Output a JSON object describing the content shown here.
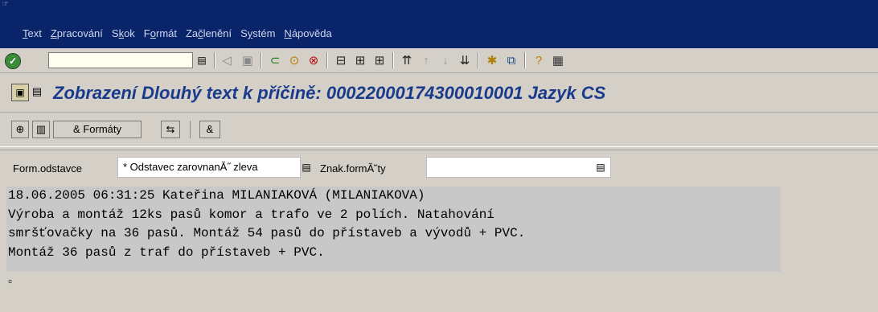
{
  "menubar": {
    "items": [
      {
        "pre": "",
        "u": "T",
        "post": "ext"
      },
      {
        "pre": "",
        "u": "Z",
        "post": "pracování"
      },
      {
        "pre": "S",
        "u": "k",
        "post": "ok"
      },
      {
        "pre": "F",
        "u": "o",
        "post": "rmát"
      },
      {
        "pre": "Za",
        "u": "č",
        "post": "lenění"
      },
      {
        "pre": "S",
        "u": "y",
        "post": "stém"
      },
      {
        "pre": "",
        "u": "N",
        "post": "ápověda"
      }
    ]
  },
  "command_field": {
    "value": ""
  },
  "title": "Zobrazení Dlouhý text k příčině: 00022000174300010001 Jazyk CS",
  "app_toolbar": {
    "formats_label": "Formáty"
  },
  "format_line": {
    "paragraph_label": "Form.odstavce",
    "paragraph_value": "* Odstavec zarovnanĂ˝ zleva",
    "char_label": "Znak.formĂ˘ty",
    "char_value": ""
  },
  "editor": {
    "lines": [
      "18.06.2005 06:31:25 Kateřina MILANIAKOVÁ (MILANIAKOVA)",
      "Výroba a montáž 12ks pasů komor a trafo ve 2 polích. Natahování",
      "smršťovačky na 36 pasů. Montáž 54 pasů do přístaveb a vývodů + PVC.",
      "Montáž 36 pasů z traf do přístaveb + PVC."
    ],
    "end_marker": "¤"
  }
}
